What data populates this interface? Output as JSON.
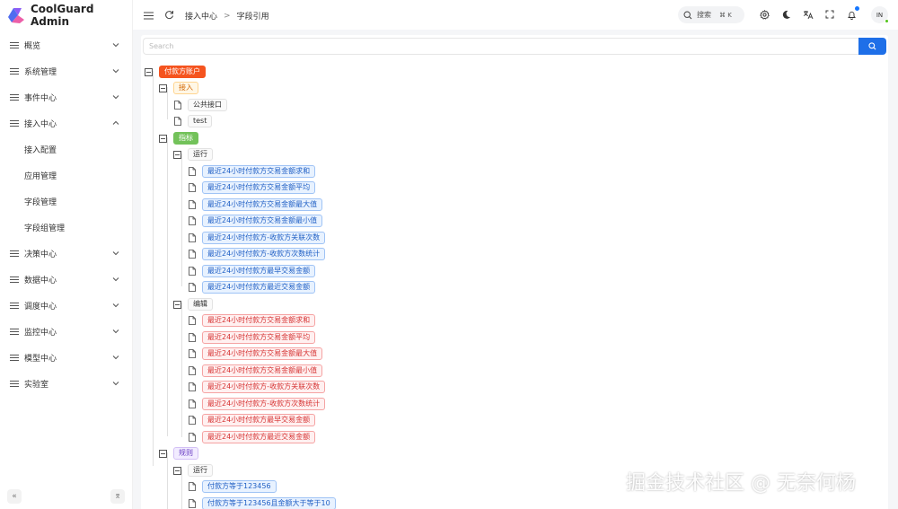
{
  "app": {
    "title": "CoolGuard Admin"
  },
  "sidebar": {
    "menu": [
      {
        "label": "概览"
      },
      {
        "label": "系统管理"
      },
      {
        "label": "事件中心"
      },
      {
        "label": "接入中心",
        "expanded": true
      },
      {
        "label": "决策中心"
      },
      {
        "label": "数据中心"
      },
      {
        "label": "调度中心"
      },
      {
        "label": "监控中心"
      },
      {
        "label": "模型中心"
      },
      {
        "label": "实验室"
      }
    ],
    "submenu": [
      {
        "label": "接入配置"
      },
      {
        "label": "应用管理"
      },
      {
        "label": "字段管理"
      },
      {
        "label": "字段组管理"
      }
    ],
    "collapse_glyph": "«",
    "pin_glyph": "⌆"
  },
  "topbar": {
    "breadcrumb": [
      "接入中心",
      "字段引用"
    ],
    "breadcrumb_sep": ">",
    "search_label": "搜索",
    "search_kbd": "⌘ K",
    "avatar_text": "IN"
  },
  "content": {
    "search_placeholder": "Search",
    "tree": {
      "root": "付款方账户",
      "access": {
        "label": "接入",
        "children": [
          "公共接口",
          "test"
        ]
      },
      "indicator": {
        "label": "指标",
        "running": {
          "label": "运行",
          "items": [
            "最近24小时付款方交易金额求和",
            "最近24小时付款方交易金额平均",
            "最近24小时付款方交易金额最大值",
            "最近24小时付款方交易金额最小值",
            "最近24小时付款方-收款方关联次数",
            "最近24小时付款方-收款方次数统计",
            "最近24小时付款方最早交易金额",
            "最近24小时付款方最近交易金额"
          ]
        },
        "editing": {
          "label": "编辑",
          "items": [
            "最近24小时付款方交易金额求和",
            "最近24小时付款方交易金额平均",
            "最近24小时付款方交易金额最大值",
            "最近24小时付款方交易金额最小值",
            "最近24小时付款方-收款方关联次数",
            "最近24小时付款方-收款方次数统计",
            "最近24小时付款方最早交易金额",
            "最近24小时付款方最近交易金额"
          ]
        }
      },
      "rules": {
        "label": "规则",
        "running": {
          "label": "运行",
          "items": [
            "付款方等于123456",
            "付款方等于123456且金额大于等于10"
          ]
        }
      }
    }
  },
  "watermark": "掘金技术社区 @ 无奈何杨"
}
